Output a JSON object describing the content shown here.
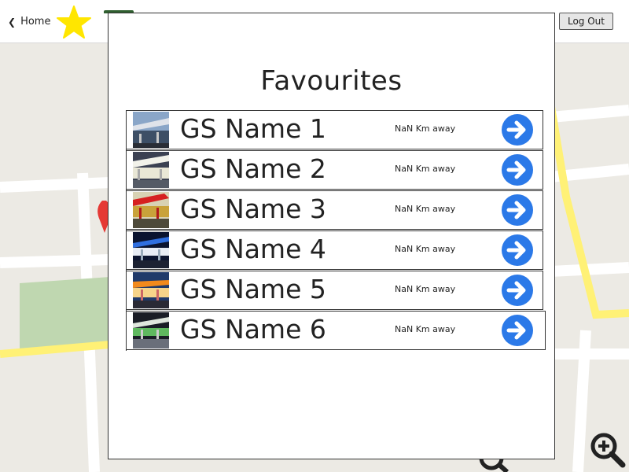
{
  "header": {
    "home_label": "Home",
    "logout_label": "Log Out"
  },
  "icons": {
    "home_chevron": "chevron-left-icon",
    "favorite": "star-icon",
    "zoom": "zoom-in-icon",
    "row_action": "arrow-right-circle-icon",
    "map_pin": "map-pin-icon"
  },
  "colors": {
    "star": "#ffe600",
    "action_blue": "#2b79e8",
    "pin": "#e53935",
    "map_road_yellow": "#fff176",
    "map_park": "#bfd7b0"
  },
  "modal": {
    "title": "Favourites",
    "items": [
      {
        "name": "GS Name 1",
        "distance": "NaN Km away"
      },
      {
        "name": "GS Name 2",
        "distance": "NaN Km away"
      },
      {
        "name": "GS Name 3",
        "distance": "NaN Km away"
      },
      {
        "name": "GS Name 4",
        "distance": "NaN Km away"
      },
      {
        "name": "GS Name 5",
        "distance": "NaN Km away"
      },
      {
        "name": "GS Name 6",
        "distance": "NaN Km away"
      }
    ]
  }
}
